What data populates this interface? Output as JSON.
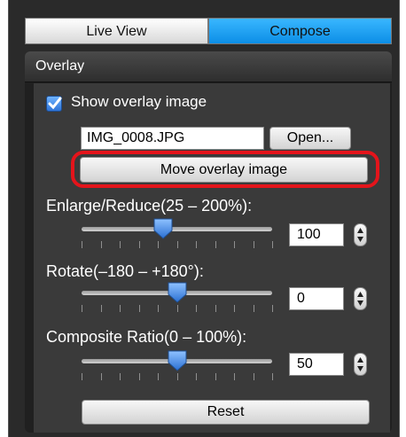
{
  "tabs": [
    {
      "label": "Live View",
      "selected": false
    },
    {
      "label": "Compose",
      "selected": true
    }
  ],
  "panel": {
    "title": "Overlay"
  },
  "overlay": {
    "show_overlay_label": "Show overlay image",
    "show_overlay_checked": true,
    "filename": "IMG_0008.JPG",
    "open_label": "Open...",
    "move_label": "Move overlay image"
  },
  "sliders": [
    {
      "label": "Enlarge/Reduce(25 – 200%):",
      "value": "100",
      "min": 25,
      "max": 200,
      "numeric_value": 100
    },
    {
      "label": "Rotate(–180 – +180°):",
      "value": "0",
      "min": -180,
      "max": 180,
      "numeric_value": 0
    },
    {
      "label": "Composite Ratio(0 – 100%):",
      "value": "50",
      "min": 0,
      "max": 100,
      "numeric_value": 50
    }
  ],
  "reset_label": "Reset",
  "colors": {
    "accent": "#0c8ee6",
    "highlight": "#e4141b",
    "checkbox": "#2f74d6"
  }
}
